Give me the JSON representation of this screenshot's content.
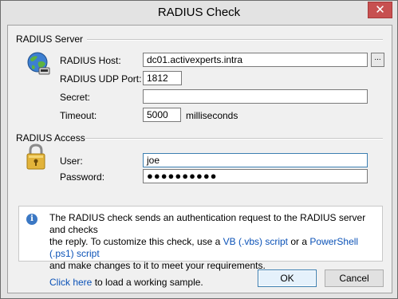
{
  "window": {
    "title": "RADIUS Check",
    "close_glyph": "✕"
  },
  "server_group": {
    "title": "RADIUS Server",
    "host_label": "RADIUS Host:",
    "host_value": "dc01.activexperts.intra",
    "browse_label": "...",
    "port_label": "RADIUS UDP Port:",
    "port_value": "1812",
    "secret_label": "Secret:",
    "secret_value": "",
    "timeout_label": "Timeout:",
    "timeout_value": "5000",
    "timeout_unit": "milliseconds",
    "icon": "globe-network-icon"
  },
  "access_group": {
    "title": "RADIUS Access",
    "user_label": "User:",
    "user_value": "joe",
    "password_label": "Password:",
    "password_value": "●●●●●●●●●●",
    "icon": "padlock-icon"
  },
  "info": {
    "line1": "The RADIUS check sends an authentication request to the RADIUS server and checks",
    "line2_a": "the reply. To customize this check, use a ",
    "vb_link": "VB (.vbs) script",
    "line2_b": " or a ",
    "ps_link": "PowerShell (.ps1) script",
    "line3": "and make changes to it to meet your requirements.",
    "click_link": "Click here",
    "line4": " to load a working sample."
  },
  "buttons": {
    "ok": "OK",
    "cancel": "Cancel"
  },
  "colors": {
    "link": "#0b52b7",
    "close": "#c75050",
    "focus": "#3c7fb1"
  }
}
